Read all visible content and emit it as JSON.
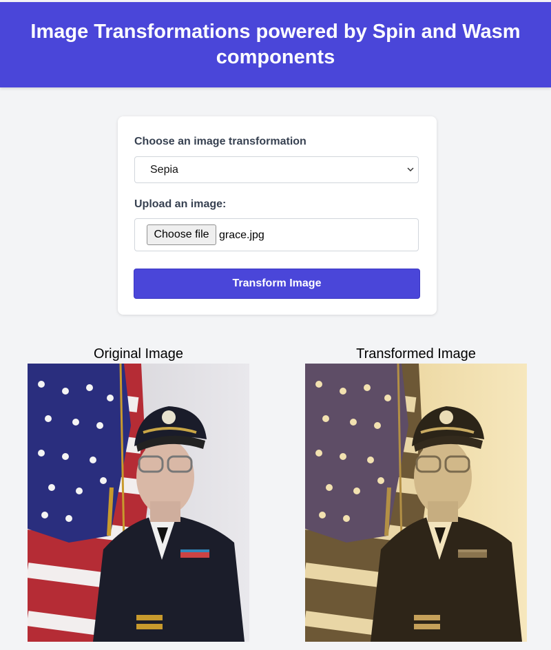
{
  "header": {
    "title": "Image Transformations powered by Spin and Wasm components"
  },
  "form": {
    "transform_label": "Choose an image transformation",
    "transform_selected": "Sepia",
    "upload_label": "Upload an image:",
    "file_button_label": "Choose file",
    "file_name": "grace.jpg",
    "submit_label": "Transform Image"
  },
  "results": {
    "original_caption": "Original Image",
    "transformed_caption": "Transformed Image"
  },
  "colors": {
    "accent": "#4a46d9",
    "background": "#f3f4f6"
  },
  "icons": {
    "select_chevron": "chevron-down-icon"
  }
}
